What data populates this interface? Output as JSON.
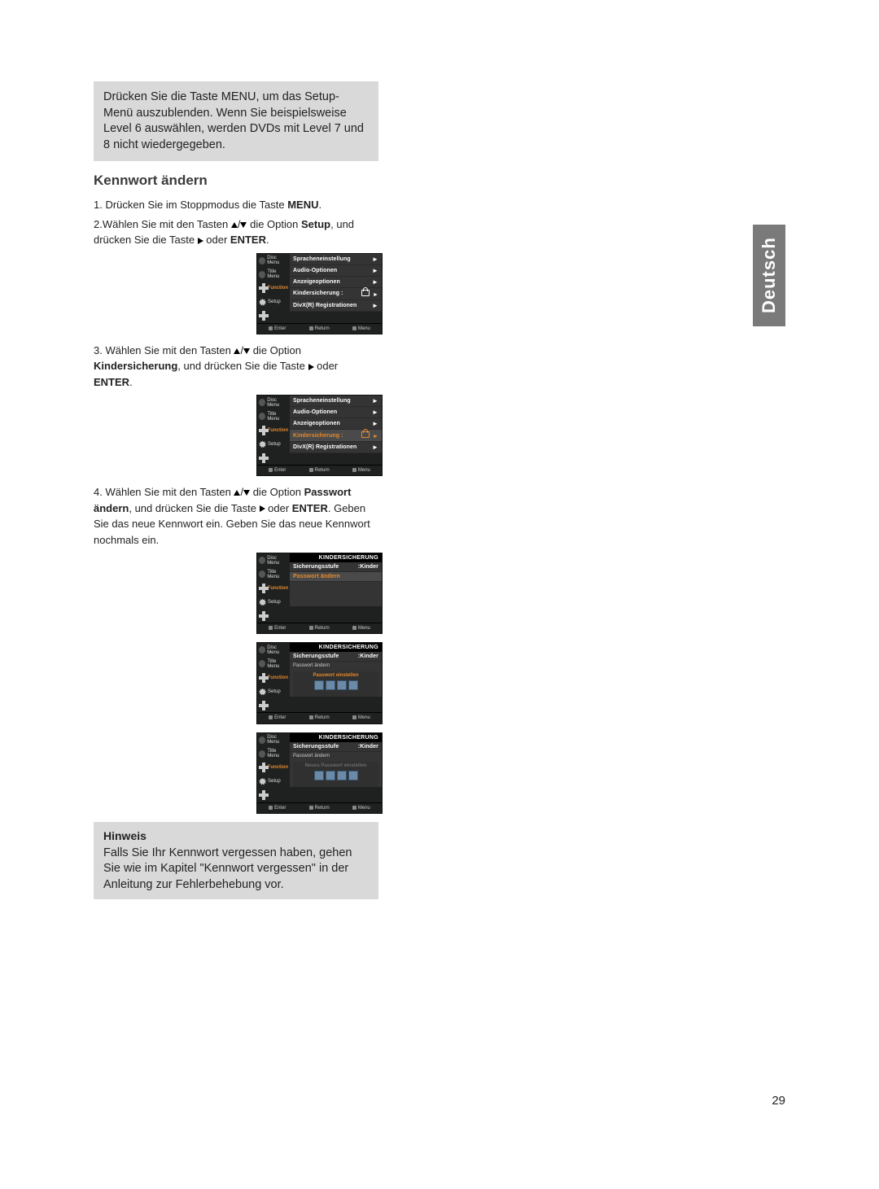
{
  "intro_box": "Drücken Sie die Taste MENU, um das Setup-Menü auszublenden. Wenn Sie beispielsweise Level 6 auswählen, werden DVDs mit Level 7 und 8 nicht wiedergegeben.",
  "heading": "Kennwort ändern",
  "step1_a": "1. Drücken Sie im Stoppmodus die Taste ",
  "step1_b": "MENU",
  "step1_c": ".",
  "step2_a": "2.Wählen Sie mit den Tasten ",
  "step2_b": " die Option ",
  "step2_c": "Setup",
  "step2_d": ", und drücken Sie die Taste ",
  "step2_e": " oder ",
  "step2_f": "ENTER",
  "step2_g": ".",
  "step3_a": "3. Wählen Sie mit den Tasten ",
  "step3_b": " die Option ",
  "step3_c": "Kindersicherung",
  "step3_d": ", und drücken Sie die Taste ",
  "step3_e": " oder ",
  "step3_f": "ENTER",
  "step3_g": ".",
  "step4_a": "4. Wählen Sie mit den Tasten ",
  "step4_b": " die Option ",
  "step4_c": "Passwort ändern",
  "step4_d": ", und drücken Sie die Taste ",
  "step4_e": " oder ",
  "step4_f": "ENTER",
  "step4_g": ". Geben Sie das neue Kennwort ein. Geben Sie das neue Kennwort nochmals ein.",
  "sidebar": {
    "disc": "Disc Menu",
    "title": "Title Menu",
    "function": "Function",
    "setup": "Setup"
  },
  "setup_menu": {
    "items": [
      "Spracheneinstellung",
      "Audio-Optionen",
      "Anzeigeoptionen",
      "Kindersicherung  :",
      "DivX(R) Registrationen"
    ]
  },
  "footer": {
    "enter": "Enter",
    "return": "Return",
    "menu": "Menu"
  },
  "kinder": {
    "header": "KINDERSICHERUNG",
    "row1_label": "Sicherungsstufe",
    "row1_value": ":Kinder",
    "row2": "Passwort ändern",
    "overlay1": "Passwort einstellen",
    "overlay2": "Neues Passwort einstellen"
  },
  "note": {
    "title": "Hinweis",
    "body": "Falls Sie Ihr Kennwort vergessen haben, gehen Sie wie im Kapitel \"Kennwort vergessen\" in der Anleitung zur Fehlerbehebung vor."
  },
  "lang_tab": "Deutsch",
  "page_number": "29"
}
